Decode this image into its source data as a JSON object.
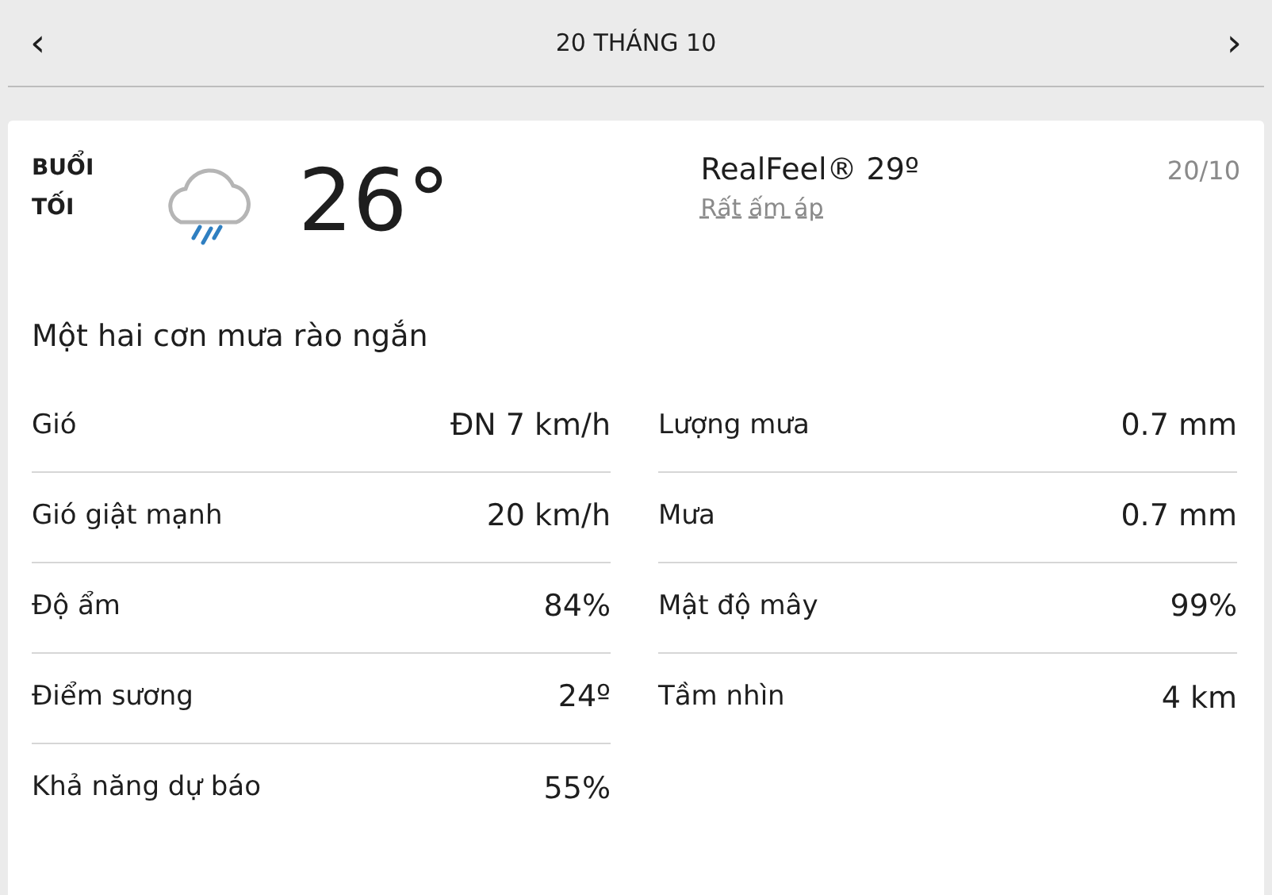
{
  "header": {
    "prev": "‹",
    "title": "20 THÁNG 10",
    "next": "›"
  },
  "card": {
    "period": "BUỔI TỐI",
    "temperature": "26°",
    "realfeel": "RealFeel® 29º",
    "realfeel_phrase": "Rất ấm áp",
    "date": "20/10",
    "description": "Một hai cơn mưa rào ngắn",
    "left_details": [
      {
        "label": "Gió",
        "value": "ĐN 7 km/h"
      },
      {
        "label": "Gió giật mạnh",
        "value": "20 km/h"
      },
      {
        "label": "Độ ẩm",
        "value": "84%"
      },
      {
        "label": "Điểm sương",
        "value": "24º"
      },
      {
        "label": "Khả năng dự báo",
        "value": "55%"
      }
    ],
    "right_details": [
      {
        "label": "Lượng mưa",
        "value": "0.7 mm"
      },
      {
        "label": "Mưa",
        "value": "0.7 mm"
      },
      {
        "label": "Mật độ mây",
        "value": "99%"
      },
      {
        "label": "Tầm nhìn",
        "value": "4 km"
      }
    ]
  }
}
